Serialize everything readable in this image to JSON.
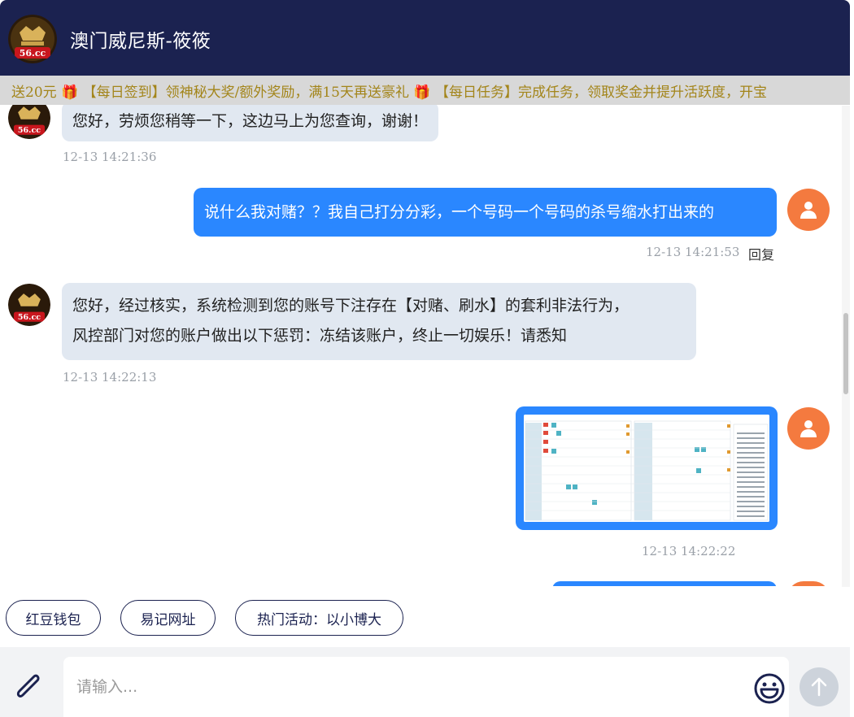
{
  "header": {
    "title": "澳门威尼斯-筱筱",
    "logo_text": "56.cc"
  },
  "marquee": {
    "text": "送20元 🎁 【每日签到】领神秘大奖/额外奖励，满15天再送豪礼 🎁 【每日任务】完成任务，领取奖金并提升活跃度，开宝"
  },
  "messages": [
    {
      "side": "in",
      "text": "您好，劳烦您稍等一下，这边马上为您查询，谢谢！",
      "time": "12-13 14:21:36"
    },
    {
      "side": "out",
      "text": "说什么我对赌？？我自己打分分彩，一个号码一个号码的杀号缩水打出来的",
      "time": "12-13 14:21:53",
      "reply": "回复"
    },
    {
      "side": "in",
      "lines": [
        "您好，经过核实，系统检测到您的账号下注存在【对赌、刷水】的套利非法行为，",
        "风控部门对您的账户做出以下惩罚：冻结该账户，终止一切娱乐！请悉知"
      ],
      "time": "12-13 14:22:13"
    },
    {
      "side": "out",
      "type": "image",
      "time": "12-13 14:22:22"
    }
  ],
  "quick_replies": [
    "红豆钱包",
    "易记网址",
    "热门活动：以小博大"
  ],
  "composer": {
    "placeholder": "请输入..."
  },
  "colors": {
    "header_bg": "#1b2250",
    "bubble_in": "#e1e8f1",
    "bubble_out": "#2a87ff",
    "user_avatar": "#f47a3f",
    "marquee_text": "#a3851a"
  }
}
